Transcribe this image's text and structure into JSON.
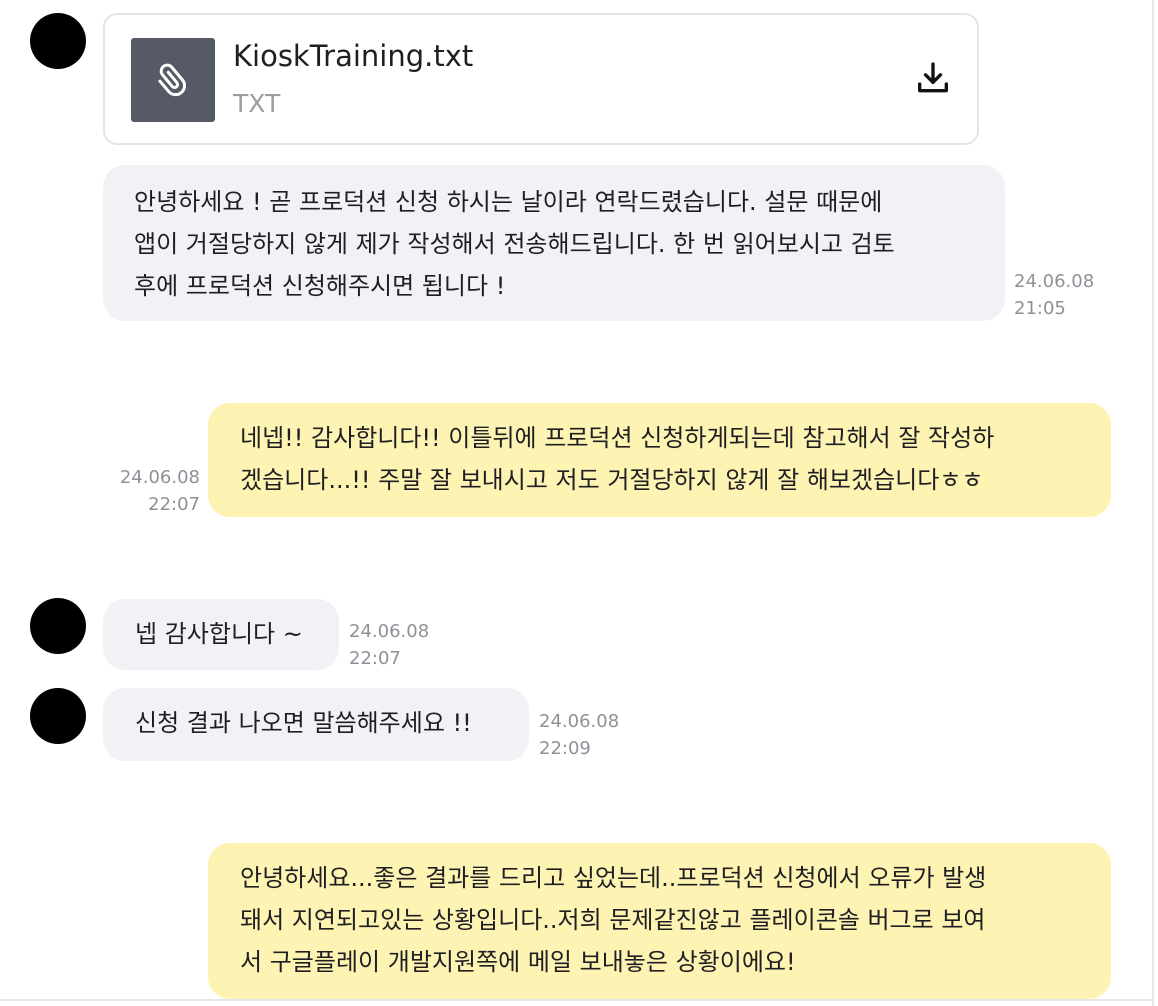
{
  "messages": [
    {
      "file": {
        "name": "KioskTraining.txt",
        "type": "TXT"
      }
    },
    {
      "lines": [
        "안녕하세요 ! 곧 프로덕션 신청 하시는 날이라 연락드렸습니다. 설문 때문에",
        "앱이 거절당하지 않게 제가 작성해서 전송해드립니다. 한 번 읽어보시고 검토",
        "후에 프로덕션 신청해주시면 됩니다 !"
      ],
      "date": "24.06.08",
      "time": "21:05"
    },
    {
      "lines": [
        "네넵!! 감사합니다!! 이틀뒤에 프로덕션 신청하게되는데 참고해서 잘 작성하",
        "겠습니다...!! 주말 잘 보내시고 저도 거절당하지 않게 잘 해보겠습니다ㅎㅎ"
      ],
      "date": "24.06.08",
      "time": "22:07"
    },
    {
      "lines": [
        "넵 감사합니다 ~"
      ],
      "date": "24.06.08",
      "time": "22:07"
    },
    {
      "lines": [
        "신청 결과 나오면 말씀해주세요 !!"
      ],
      "date": "24.06.08",
      "time": "22:09"
    },
    {
      "lines": [
        "안녕하세요...좋은 결과를 드리고 싶었는데..프로덕션 신청에서 오류가 발생",
        "돼서 지연되고있는 상황입니다..저희 문제같진않고 플레이콘솔 버그로 보여",
        "서 구글플레이 개발지원쪽에 메일 보내놓은 상황이에요!"
      ]
    }
  ],
  "icons": {
    "attachment": "paperclip-icon",
    "download": "download-icon"
  },
  "colors": {
    "incoming_bubble": "#f1f2f5",
    "outgoing_bubble": "#fdf3b2",
    "file_thumb": "#565966",
    "timestamp": "#8f9198",
    "avatar": "#000000"
  }
}
